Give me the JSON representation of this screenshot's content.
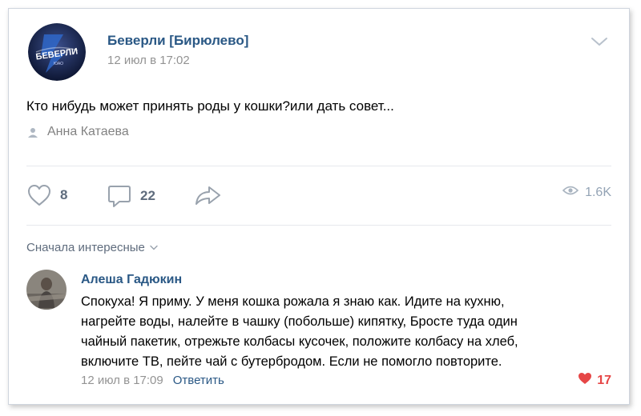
{
  "post": {
    "author": "Беверли [Бирюлево]",
    "date": "12 июл в 17:02",
    "avatar_icon": "community-logo-icon",
    "text": "Кто нибудь может принять роды у кошки?или дать совет...",
    "signer": "Анна Катаева"
  },
  "actions": {
    "like_count": "8",
    "comment_count": "22",
    "views_count": "1.6K"
  },
  "comments_sort": {
    "label": "Сначала интересные"
  },
  "comment": {
    "author": "Алеша Гадюкин",
    "lines": [
      "Спокуха! Я приму. У меня кошка рожала я знаю как. Идите на кухню,",
      "нагрейте воды, налейте в чашку (побольше) кипятку, Бросте туда один",
      "чайный пакетик, отрежьте колбасы кусочек, положите колбасу на хлеб,",
      "включите ТВ, пейте чай с бутербродом. Если не помогло повторите."
    ],
    "date": "12 июл в 17:09",
    "reply_label": "Ответить",
    "like_count": "17"
  },
  "colors": {
    "link": "#2a5885",
    "muted": "#939393",
    "action_icon": "#99a2ad",
    "like_red": "#e64646"
  }
}
